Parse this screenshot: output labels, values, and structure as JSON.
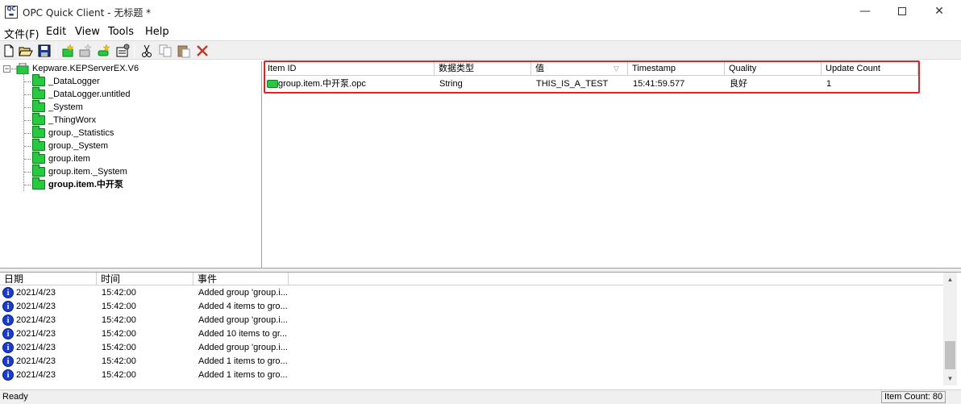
{
  "window": {
    "title": "OPC Quick Client - 无标题 *",
    "app_icon_text_top": "QC",
    "controls": {
      "minimize": "—",
      "close": "✕"
    }
  },
  "menu": [
    "文件(F)",
    "Edit",
    "View",
    "Tools",
    "Help"
  ],
  "toolbar": {
    "buttons": [
      "new-file",
      "open-file",
      "save",
      "new-server",
      "new-group",
      "new-item",
      "properties",
      "cut",
      "copy",
      "paste",
      "delete"
    ]
  },
  "tree": {
    "root": "Kepware.KEPServerEX.V6",
    "expander": "−",
    "children": [
      {
        "label": "_DataLogger",
        "selected": false
      },
      {
        "label": "_DataLogger.untitled",
        "selected": false
      },
      {
        "label": "_System",
        "selected": false
      },
      {
        "label": "_ThingWorx",
        "selected": false
      },
      {
        "label": "group._Statistics",
        "selected": false
      },
      {
        "label": "group._System",
        "selected": false
      },
      {
        "label": "group.item",
        "selected": false
      },
      {
        "label": "group.item._System",
        "selected": false
      },
      {
        "label": "group.item.中开泵",
        "selected": true
      }
    ]
  },
  "items": {
    "columns": [
      "Item ID",
      "数据类型",
      "值",
      "Timestamp",
      "Quality",
      "Update Count"
    ],
    "sort_glyph": "▽",
    "rows": [
      {
        "item_id": "group.item.中开泵.opc",
        "data_type": "String",
        "value": "THIS_IS_A_TEST",
        "timestamp": "15:41:59.577",
        "quality": "良好",
        "update_count": "1"
      }
    ]
  },
  "log": {
    "columns": [
      "日期",
      "时间",
      "事件"
    ],
    "icon": "i",
    "rows": [
      {
        "date": "2021/4/23",
        "time": "15:42:00",
        "event": "Added group 'group.i..."
      },
      {
        "date": "2021/4/23",
        "time": "15:42:00",
        "event": "Added 4 items to gro..."
      },
      {
        "date": "2021/4/23",
        "time": "15:42:00",
        "event": "Added group 'group.i..."
      },
      {
        "date": "2021/4/23",
        "time": "15:42:00",
        "event": "Added 10 items to gr..."
      },
      {
        "date": "2021/4/23",
        "time": "15:42:00",
        "event": "Added group 'group.i..."
      },
      {
        "date": "2021/4/23",
        "time": "15:42:00",
        "event": "Added 1 items to gro..."
      },
      {
        "date": "2021/4/23",
        "time": "15:42:00",
        "event": "Added 1 items to gro..."
      }
    ],
    "scroll_up": "▲",
    "scroll_down": "▼"
  },
  "status": {
    "left": "Ready",
    "right": "Item Count: 80"
  },
  "colors": {
    "highlight_box": "#e52222",
    "folder_green": "#27c93f",
    "info_blue": "#1a3ccf"
  }
}
